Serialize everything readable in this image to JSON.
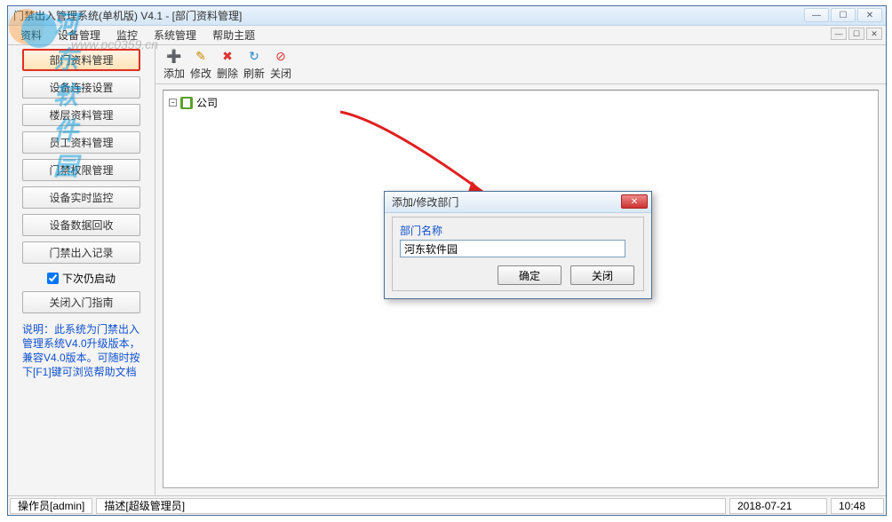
{
  "window": {
    "title": "门禁出入管理系统(单机版) V4.1 - [部门资料管理]"
  },
  "menu": {
    "items": [
      "资料",
      "设备管理",
      "监控",
      "系统管理",
      "帮助主题"
    ]
  },
  "sidebar": {
    "buttons": [
      "部门资料管理",
      "设备连接设置",
      "楼层资料管理",
      "员工资料管理",
      "门禁权限管理",
      "设备实时监控",
      "设备数据回收",
      "门禁出入记录"
    ],
    "checkbox_label": "下次仍启动",
    "close_guide": "关闭入门指南",
    "note": "说明：此系统为门禁出入管理系统V4.0升级版本，兼容V4.0版本。可随时按下[F1]键可浏览帮助文档"
  },
  "toolbar": {
    "buttons": [
      {
        "label": "添加",
        "icon": "➕",
        "name": "add"
      },
      {
        "label": "修改",
        "icon": "✎",
        "name": "edit"
      },
      {
        "label": "删除",
        "icon": "✖",
        "name": "delete"
      },
      {
        "label": "刷新",
        "icon": "↻",
        "name": "refresh"
      },
      {
        "label": "关闭",
        "icon": "⊘",
        "name": "close"
      }
    ]
  },
  "tree": {
    "root": "公司"
  },
  "dialog": {
    "title": "添加/修改部门",
    "field_label": "部门名称",
    "field_value": "河东软件园",
    "ok": "确定",
    "close": "关闭"
  },
  "status": {
    "operator": "操作员[admin]",
    "desc": "描述[超级管理员]",
    "date": "2018-07-21",
    "time": "10:48"
  },
  "watermark": {
    "brand": "河东软件园",
    "url": "www.pc0359.cn"
  }
}
